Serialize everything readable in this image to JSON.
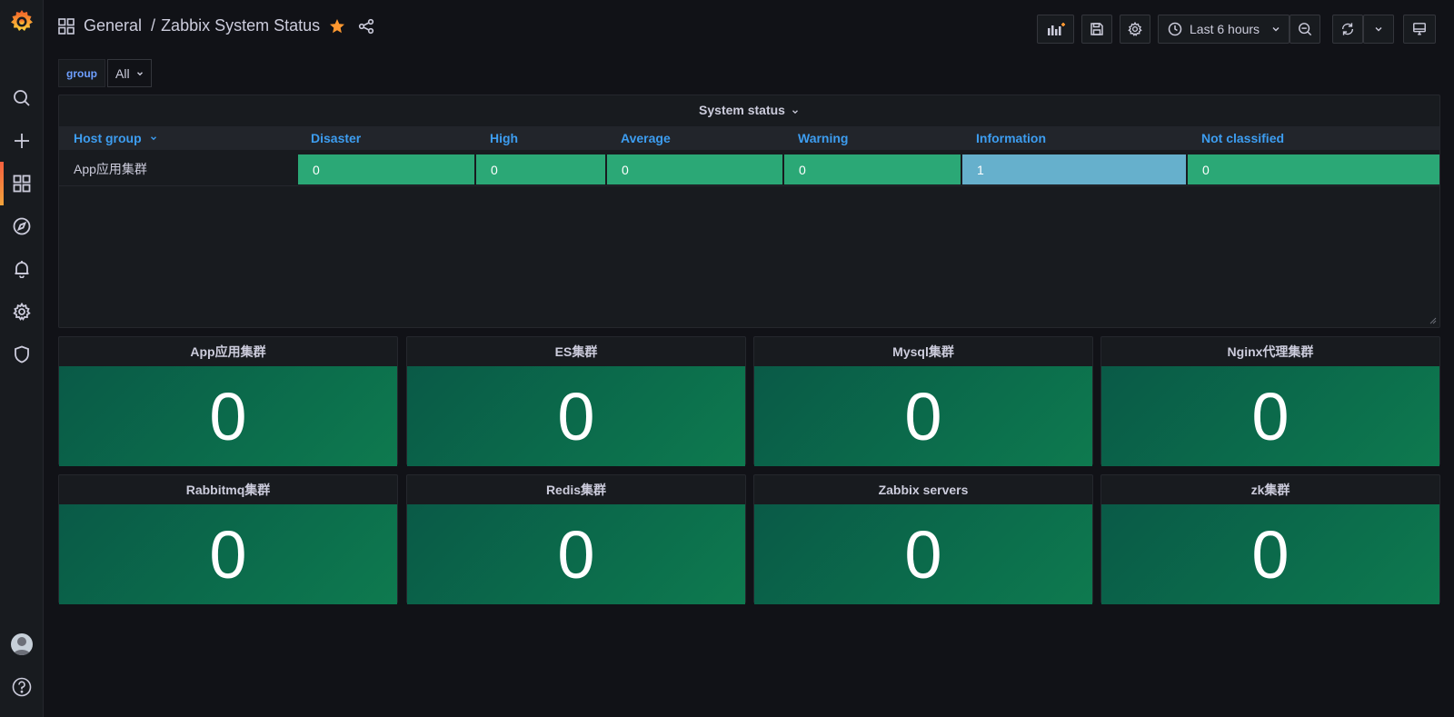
{
  "colors": {
    "ok": "#2ba876",
    "info": "#66b0cc",
    "accent": "#f55f3e",
    "star": "#ff9830"
  },
  "sidebar": {
    "items": [
      {
        "name": "search-icon"
      },
      {
        "name": "plus-icon"
      },
      {
        "name": "dashboards-icon"
      },
      {
        "name": "explore-icon"
      },
      {
        "name": "alerting-icon"
      },
      {
        "name": "configuration-icon"
      },
      {
        "name": "server-admin-icon"
      }
    ]
  },
  "header": {
    "folder": "General",
    "separator": "/",
    "title": "Zabbix System Status",
    "time_range": "Last 6 hours"
  },
  "variables": {
    "label": "group",
    "value": "All"
  },
  "status_panel": {
    "title": "System status",
    "columns": [
      "Host group",
      "Disaster",
      "High",
      "Average",
      "Warning",
      "Information",
      "Not classified"
    ],
    "rows": [
      {
        "host": "App应用集群",
        "values": [
          "0",
          "0",
          "0",
          "0",
          "1",
          "0"
        ]
      }
    ]
  },
  "stats": [
    {
      "title": "App应用集群",
      "value": "0"
    },
    {
      "title": "ES集群",
      "value": "0"
    },
    {
      "title": "Mysql集群",
      "value": "0"
    },
    {
      "title": "Nginx代理集群",
      "value": "0"
    },
    {
      "title": "Rabbitmq集群",
      "value": "0"
    },
    {
      "title": "Redis集群",
      "value": "0"
    },
    {
      "title": "Zabbix servers",
      "value": "0"
    },
    {
      "title": "zk集群",
      "value": "0"
    }
  ]
}
